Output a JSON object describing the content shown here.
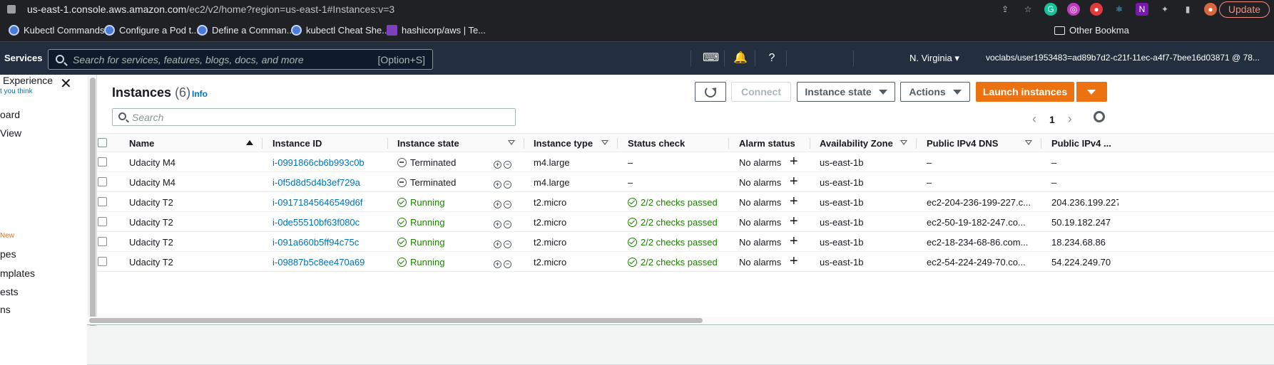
{
  "browser": {
    "url_host": "us-east-1.console.aws.amazon.com",
    "url_path": "/ec2/v2/home?region=us-east-1#Instances:v=3",
    "update_label": "Update",
    "bookmarks": [
      "Kubectl Commands",
      "Configure a Pod t...",
      "Define a Comman...",
      "kubectl Cheat She...",
      "hashicorp/aws | Te..."
    ],
    "other_bookmarks": "Other Bookma"
  },
  "awsnav": {
    "services_label": "Services",
    "search_placeholder": "Search for services, features, blogs, docs, and more",
    "search_shortcut": "[Option+S]",
    "region": "N. Virginia",
    "account": "voclabs/user1953483=ad89b7d2-c21f-11ec-a4f7-7bee16d03871 @ 78..."
  },
  "sidebar": {
    "experience_title": "Experience",
    "experience_sub": "t you think",
    "items": [
      "oard",
      "View",
      "New",
      "pes",
      "mplates",
      "ests",
      "ns"
    ]
  },
  "main": {
    "title": "Instances",
    "count": "(6)",
    "info": "Info",
    "connect_label": "Connect",
    "instance_state_label": "Instance state",
    "actions_label": "Actions",
    "launch_label": "Launch instances",
    "search_placeholder": "Search",
    "page": "1"
  },
  "table": {
    "headers": {
      "name": "Name",
      "instance_id": "Instance ID",
      "instance_state": "Instance state",
      "instance_type": "Instance type",
      "status_check": "Status check",
      "alarm_status": "Alarm status",
      "az": "Availability Zone",
      "dns": "Public IPv4 DNS",
      "ipv4": "Public IPv4 ..."
    },
    "rows": [
      {
        "name": "Udacity M4",
        "id": "i-0991866cb6b993c0b",
        "state": "Terminated",
        "type": "m4.large",
        "status": "–",
        "alarm": "No alarms",
        "az": "us-east-1b",
        "dns": "–",
        "ip": "–"
      },
      {
        "name": "Udacity M4",
        "id": "i-0f5d8d5d4b3ef729a",
        "state": "Terminated",
        "type": "m4.large",
        "status": "–",
        "alarm": "No alarms",
        "az": "us-east-1b",
        "dns": "–",
        "ip": "–"
      },
      {
        "name": "Udacity T2",
        "id": "i-09171845646549d6f",
        "state": "Running",
        "type": "t2.micro",
        "status": "2/2 checks passed",
        "alarm": "No alarms",
        "az": "us-east-1b",
        "dns": "ec2-204-236-199-227.c...",
        "ip": "204.236.199.227"
      },
      {
        "name": "Udacity T2",
        "id": "i-0de55510bf63f080c",
        "state": "Running",
        "type": "t2.micro",
        "status": "2/2 checks passed",
        "alarm": "No alarms",
        "az": "us-east-1b",
        "dns": "ec2-50-19-182-247.co...",
        "ip": "50.19.182.247"
      },
      {
        "name": "Udacity T2",
        "id": "i-091a660b5ff94c75c",
        "state": "Running",
        "type": "t2.micro",
        "status": "2/2 checks passed",
        "alarm": "No alarms",
        "az": "us-east-1b",
        "dns": "ec2-18-234-68-86.com...",
        "ip": "18.234.68.86"
      },
      {
        "name": "Udacity T2",
        "id": "i-09887b5c8ee470a69",
        "state": "Running",
        "type": "t2.micro",
        "status": "2/2 checks passed",
        "alarm": "No alarms",
        "az": "us-east-1b",
        "dns": "ec2-54-224-249-70.co...",
        "ip": "54.224.249.70"
      }
    ]
  },
  "colors": {
    "aws_nav": "#232f3e",
    "primary": "#ec7211",
    "link": "#0073bb",
    "success": "#1d8102"
  }
}
